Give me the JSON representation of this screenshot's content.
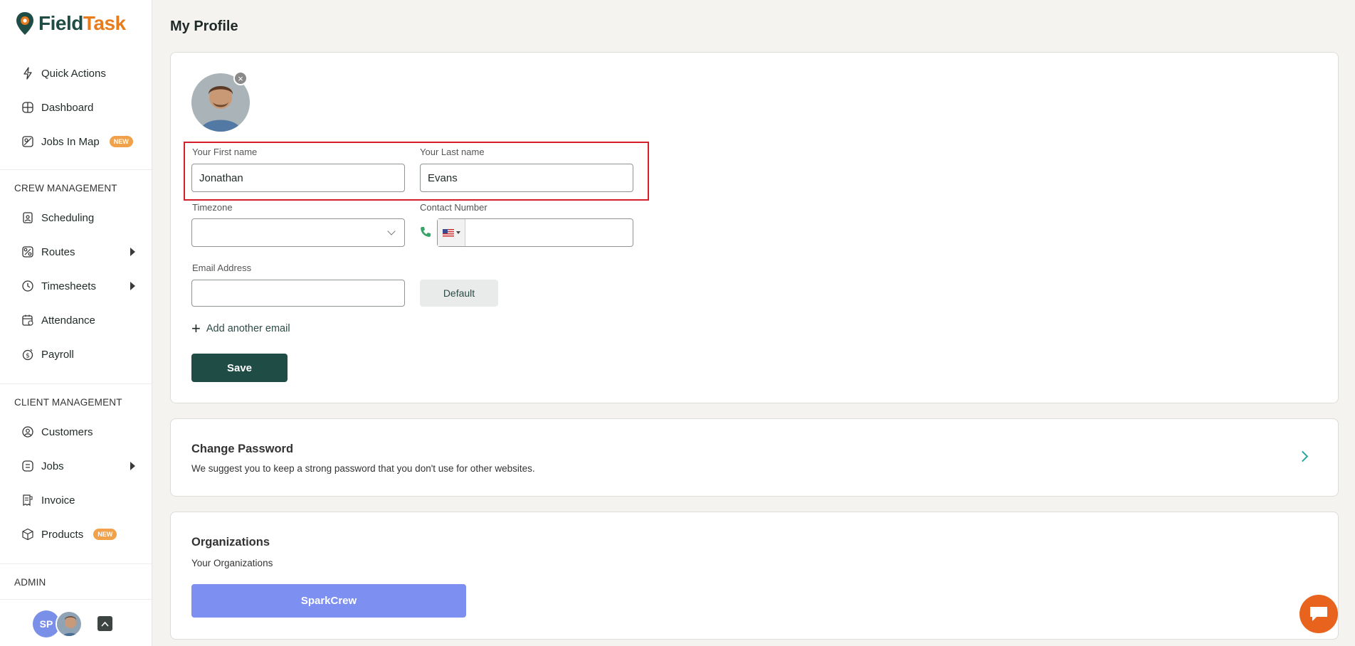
{
  "app": {
    "logo_part1": "Field",
    "logo_part2": "Task"
  },
  "sidebar": {
    "top_items": [
      {
        "label": "Quick Actions",
        "icon": "lightning-icon"
      },
      {
        "label": "Dashboard",
        "icon": "grid-icon"
      },
      {
        "label": "Jobs In Map",
        "icon": "map-icon",
        "badge": "NEW"
      }
    ],
    "crew_section_title": "CREW MANAGEMENT",
    "crew_items": [
      {
        "label": "Scheduling",
        "icon": "calendar-user-icon"
      },
      {
        "label": "Routes",
        "icon": "route-icon",
        "expandable": true
      },
      {
        "label": "Timesheets",
        "icon": "clock-icon",
        "expandable": true
      },
      {
        "label": "Attendance",
        "icon": "attendance-icon"
      },
      {
        "label": "Payroll",
        "icon": "payroll-icon"
      }
    ],
    "client_section_title": "CLIENT MANAGEMENT",
    "client_items": [
      {
        "label": "Customers",
        "icon": "user-circle-icon"
      },
      {
        "label": "Jobs",
        "icon": "jobs-list-icon",
        "expandable": true
      },
      {
        "label": "Invoice",
        "icon": "invoice-icon"
      },
      {
        "label": "Products",
        "icon": "box-icon",
        "badge": "NEW"
      }
    ],
    "admin_section_title": "ADMIN",
    "user_initials": "SP"
  },
  "page": {
    "title": "My Profile"
  },
  "profile": {
    "first_name_label": "Your First name",
    "first_name_value": "Jonathan",
    "last_name_label": "Your Last name",
    "last_name_value": "Evans",
    "timezone_label": "Timezone",
    "timezone_value": "",
    "contact_label": "Contact Number",
    "contact_value": "",
    "email_label": "Email Address",
    "email_value": "",
    "default_label": "Default",
    "add_email_label": "Add another email",
    "save_label": "Save"
  },
  "password_card": {
    "title": "Change Password",
    "description": "We suggest you to keep a strong password that you don't use for other websites."
  },
  "org_card": {
    "title": "Organizations",
    "subtitle": "Your Organizations",
    "org_name": "SparkCrew"
  },
  "colors": {
    "brand_dark": "#1f4d46",
    "brand_orange": "#e87b1c",
    "highlight_red": "#d4202a",
    "org_button": "#7d8ff0",
    "chat_orange": "#e8631e"
  }
}
